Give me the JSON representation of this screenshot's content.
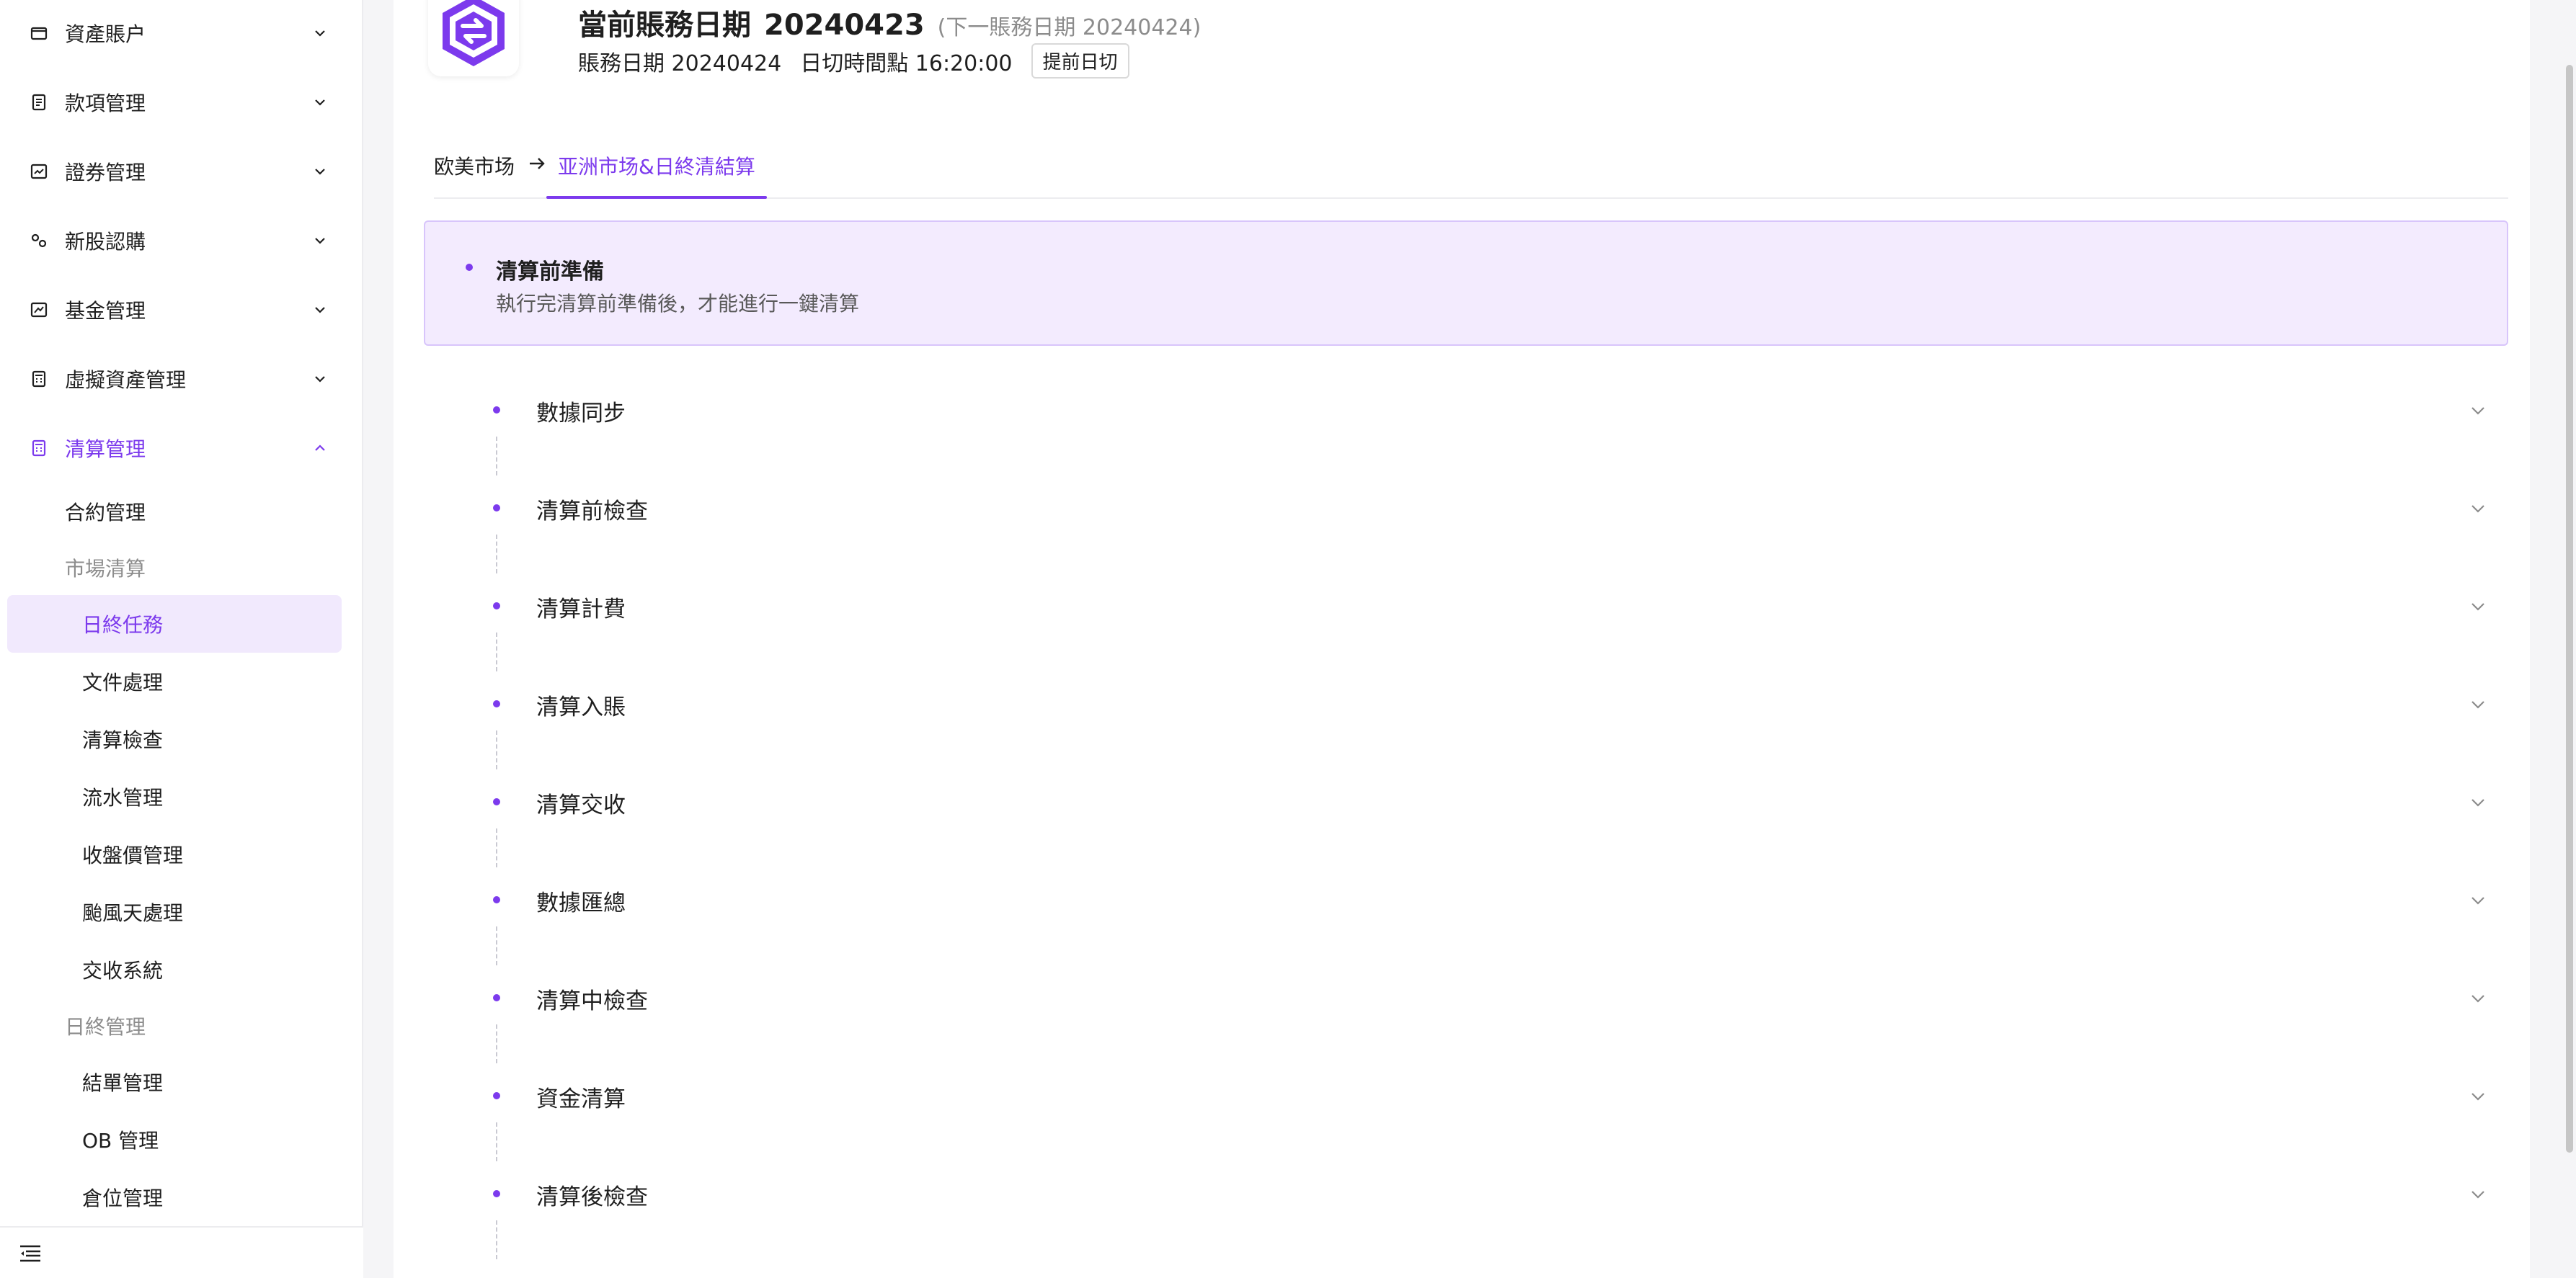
{
  "sidebar": {
    "menu": [
      {
        "label": "資產賬户",
        "icon": "wallet-icon",
        "expanded": false
      },
      {
        "label": "款項管理",
        "icon": "receipt-icon",
        "expanded": false
      },
      {
        "label": "證券管理",
        "icon": "chart-card-icon",
        "expanded": false
      },
      {
        "label": "新股認購",
        "icon": "subscribe-icon",
        "expanded": false
      },
      {
        "label": "基金管理",
        "icon": "trend-icon",
        "expanded": false
      },
      {
        "label": "虛擬資產管理",
        "icon": "calculator-icon",
        "expanded": false
      },
      {
        "label": "清算管理",
        "icon": "calculator-icon",
        "expanded": true
      }
    ],
    "sub": [
      {
        "label": "合約管理",
        "level": 1
      },
      {
        "label": "市場清算",
        "level": "group"
      },
      {
        "label": "日終任務",
        "level": 2,
        "selected": true
      },
      {
        "label": "文件處理",
        "level": 2
      },
      {
        "label": "清算檢查",
        "level": 2
      },
      {
        "label": "流水管理",
        "level": 2
      },
      {
        "label": "收盤價管理",
        "level": 2
      },
      {
        "label": "颱風天處理",
        "level": 2
      },
      {
        "label": "交收系統",
        "level": 2
      },
      {
        "label": "日終管理",
        "level": "group"
      },
      {
        "label": "結單管理",
        "level": 2
      },
      {
        "label": "OB 管理",
        "level": 2
      },
      {
        "label": "倉位管理",
        "level": 2
      }
    ]
  },
  "header": {
    "current_date_label": "當前賬務日期",
    "current_date": "20240423",
    "next_date_text": "(下一賬務日期   20240424)",
    "business_date": "賬務日期 20240424",
    "cutoff_time": "日切時間點 16:20:00",
    "advance_button": "提前日切"
  },
  "tabs": {
    "first": "欧美市场",
    "second": "亚洲市场&日終清結算"
  },
  "prep": {
    "title": "清算前準備",
    "description": "執行完清算前準備後，才能進行一鍵清算"
  },
  "steps": [
    "數據同步",
    "清算前檢查",
    "清算計費",
    "清算入賬",
    "清算交收",
    "數據匯總",
    "清算中檢查",
    "資金清算",
    "清算後檢查"
  ],
  "colors": {
    "accent": "#7c3aed",
    "panel_bg": "#f3ebfe",
    "selected_bg": "#f1e9fd"
  }
}
